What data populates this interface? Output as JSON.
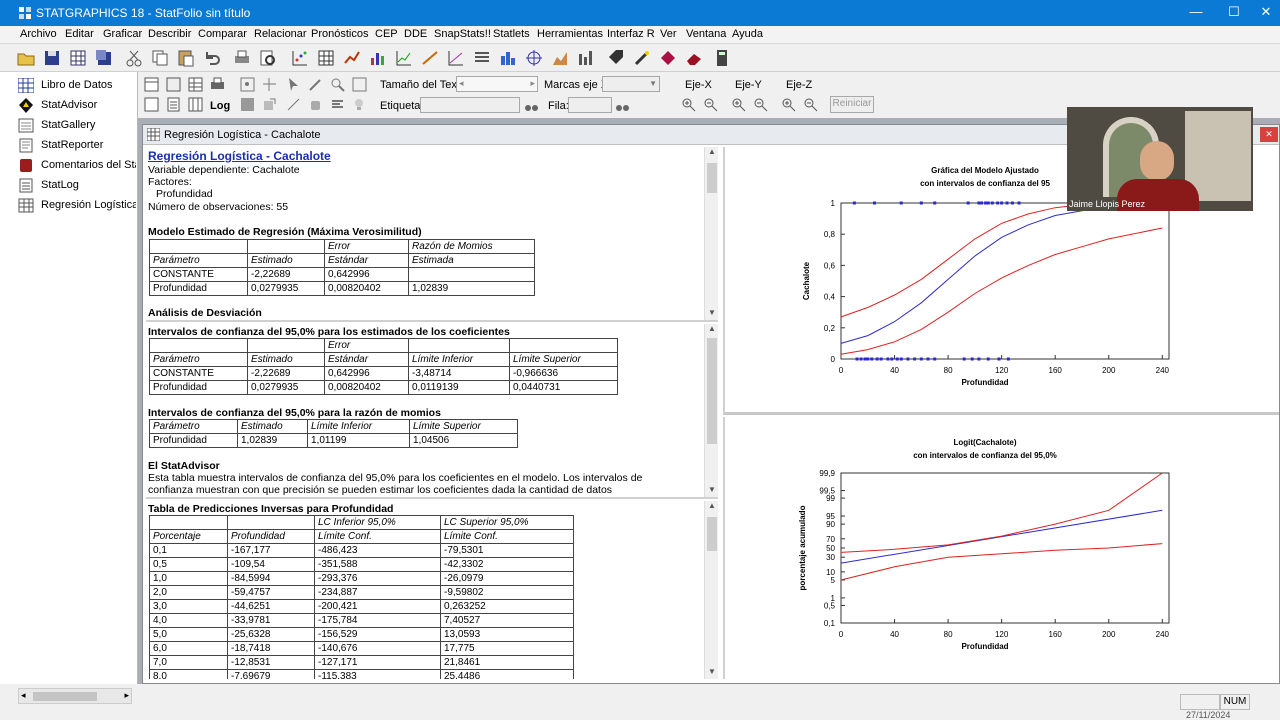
{
  "window": {
    "title": "STATGRAPHICS 18 - StatFolio sin título",
    "min": "—",
    "max": "☐",
    "close": "✕"
  },
  "menu": [
    "Archivo",
    "Editar",
    "Graficar",
    "Describir",
    "Comparar",
    "Relacionar",
    "Pronósticos",
    "CEP",
    "DDE",
    "SnapStats!!",
    "Statlets",
    "Herramientas",
    "Interfaz R",
    "Ver",
    "Ventana",
    "Ayuda"
  ],
  "sidebar": {
    "items": [
      {
        "label": "Libro de Datos",
        "icon": "grid-icon"
      },
      {
        "label": "StatAdvisor",
        "icon": "advisor-icon"
      },
      {
        "label": "StatGallery",
        "icon": "gallery-icon"
      },
      {
        "label": "StatReporter",
        "icon": "reporter-icon"
      },
      {
        "label": "Comentarios del StatFolio",
        "icon": "comments-icon"
      },
      {
        "label": "StatLog",
        "icon": "log-icon"
      },
      {
        "label": "Regresión Logística - Cachalote",
        "icon": "regression-icon"
      }
    ]
  },
  "toolbar2": {
    "text_size_label": "Tamaño del Texto:",
    "ticks_label": "Marcas eje X:",
    "label_label": "Etiqueta:",
    "row_label": "Fila:",
    "eje_x": "Eje-X",
    "eje_y": "Eje-Y",
    "eje_z": "Eje-Z",
    "reset": "Reiniciar"
  },
  "doc_window": {
    "title": "Regresión Logística - Cachalote"
  },
  "pane1": {
    "heading": "Regresión Logística - Cachalote",
    "lines": [
      "Variable dependiente: Cachalote",
      "Factores:",
      "Profundidad",
      "Número de observaciones: 55"
    ],
    "model_title": "Modelo Estimado de Regresión  (Máxima Verosimilitud)",
    "model_table": [
      [
        "",
        "",
        "Error",
        "Razón de Momios"
      ],
      [
        "Parámetro",
        "Estimado",
        "Estándar",
        "Estimada"
      ],
      [
        "CONSTANTE",
        "-2,22689",
        "0,642996",
        ""
      ],
      [
        "Profundidad",
        "0,0279935",
        "0,00820402",
        "1,02839"
      ]
    ],
    "deviance_title": "Análisis de Desviación"
  },
  "pane2": {
    "ci_title": "Intervalos de confianza del 95,0% para los estimados de los coeficientes",
    "ci_table": [
      [
        "",
        "",
        "Error",
        "",
        ""
      ],
      [
        "Parámetro",
        "Estimado",
        "Estándar",
        "Límite Inferior",
        "Límite Superior"
      ],
      [
        "CONSTANTE",
        "-2,22689",
        "0,642996",
        "-3,48714",
        "-0,966636"
      ],
      [
        "Profundidad",
        "0,0279935",
        "0,00820402",
        "0,0119139",
        "0,0440731"
      ]
    ],
    "or_title": "Intervalos de confianza del 95,0% para la razón de momios",
    "or_table": [
      [
        "Parámetro",
        "Estimado",
        "Límite Inferior",
        "Límite Superior"
      ],
      [
        "Profundidad",
        "1,02839",
        "1,01199",
        "1,04506"
      ]
    ],
    "advisor_title": "El StatAdvisor",
    "advisor_line1": "Esta tabla muestra intervalos de confianza del 95,0% para los coeficientes en el modelo.  Los intervalos de",
    "advisor_line2": "confianza muestran con que precisión se pueden estimar los coeficientes dada la cantidad de datos"
  },
  "pane3": {
    "title": "Tabla de Predicciones Inversas para Profundidad",
    "header1": [
      "",
      "",
      "LC Inferior 95,0%",
      "LC Superior 95,0%"
    ],
    "header2": [
      "Porcentaje",
      "Profundidad",
      "Límite Conf.",
      "Límite Conf."
    ],
    "rows": [
      [
        "0,1",
        "-167,177",
        "-486,423",
        "-79,5301"
      ],
      [
        "0,5",
        "-109,54",
        "-351,588",
        "-42,3302"
      ],
      [
        "1,0",
        "-84,5994",
        "-293,376",
        "-26,0979"
      ],
      [
        "2,0",
        "-59,4757",
        "-234,887",
        "-9,59802"
      ],
      [
        "3,0",
        "-44,6251",
        "-200,421",
        "0,263252"
      ],
      [
        "4,0",
        "-33,9781",
        "-175,784",
        "7,40527"
      ],
      [
        "5,0",
        "-25,6328",
        "-156,529",
        "13,0593"
      ],
      [
        "6,0",
        "-18,7418",
        "-140,676",
        "17,775"
      ],
      [
        "7,0",
        "-12,8531",
        "-127,171",
        "21,8461"
      ],
      [
        "8,0",
        "-7,69679",
        "-115,383",
        "25,4486"
      ]
    ]
  },
  "chart_data": [
    {
      "type": "line",
      "title": "Gráfica del Modelo Ajustado",
      "subtitle": "con intervalos de confianza del 95",
      "xlabel": "Profundidad",
      "ylabel": "Cachalote",
      "xlim": [
        0,
        245
      ],
      "ylim": [
        0,
        1
      ],
      "xticks": [
        "0",
        "40",
        "80",
        "120",
        "160",
        "200",
        "240"
      ],
      "yticks": [
        "0",
        "0,2",
        "0,4",
        "0,6",
        "0,8",
        "1"
      ],
      "series": [
        {
          "color": "#2a2ad0",
          "x": [
            0,
            20,
            40,
            60,
            80,
            100,
            120,
            140,
            160,
            180,
            200,
            240
          ],
          "y": [
            0.1,
            0.15,
            0.24,
            0.36,
            0.51,
            0.66,
            0.78,
            0.86,
            0.92,
            0.95,
            0.97,
            0.99
          ]
        },
        {
          "color": "#e02020",
          "x": [
            0,
            20,
            40,
            60,
            80,
            100,
            120,
            140,
            160,
            180,
            200,
            240
          ],
          "y": [
            0.27,
            0.33,
            0.41,
            0.51,
            0.64,
            0.77,
            0.87,
            0.93,
            0.97,
            0.99,
            1.0,
            1.0
          ]
        },
        {
          "color": "#e02020",
          "x": [
            0,
            20,
            40,
            60,
            80,
            100,
            120,
            140,
            160,
            180,
            200,
            240
          ],
          "y": [
            0.03,
            0.06,
            0.11,
            0.19,
            0.3,
            0.42,
            0.52,
            0.6,
            0.67,
            0.72,
            0.77,
            0.84
          ]
        }
      ],
      "points_y1_x": [
        10,
        25,
        45,
        60,
        70,
        95,
        103,
        105,
        108,
        110,
        113,
        117,
        120,
        124,
        128,
        133
      ],
      "points_y0_x": [
        12,
        15,
        18,
        20,
        23,
        27,
        30,
        35,
        38,
        42,
        45,
        50,
        55,
        60,
        65,
        70,
        92,
        98,
        103,
        110,
        118,
        125
      ]
    },
    {
      "type": "line",
      "title": "Logit(Cachalote)",
      "subtitle": "con intervalos de confianza del  95,0%",
      "xlabel": "Profundidad",
      "ylabel": "porcentaje acumulado",
      "xlim": [
        0,
        245
      ],
      "xticks": [
        "0",
        "40",
        "80",
        "120",
        "160",
        "200",
        "240"
      ],
      "yticks": [
        "0,1",
        "0,5",
        "1",
        "5",
        "10",
        "30",
        "50",
        "70",
        "90",
        "95",
        "99",
        "99,5",
        "99,9"
      ],
      "series": [
        {
          "color": "#2a2ad0",
          "x": [
            0,
            240
          ],
          "y": [
            20,
            97
          ]
        },
        {
          "color": "#e02020",
          "x": [
            0,
            40,
            80,
            120,
            160,
            200,
            240
          ],
          "y": [
            40,
            47,
            57,
            75,
            90,
            97,
            99.9
          ]
        },
        {
          "color": "#e02020",
          "x": [
            0,
            40,
            80,
            120,
            160,
            200,
            240
          ],
          "y": [
            5,
            15,
            30,
            37,
            45,
            50,
            60
          ]
        }
      ]
    }
  ],
  "video": {
    "name": "Jaime Llopis Perez"
  },
  "status": {
    "num": "NUM",
    "date": "27/11/2024"
  }
}
